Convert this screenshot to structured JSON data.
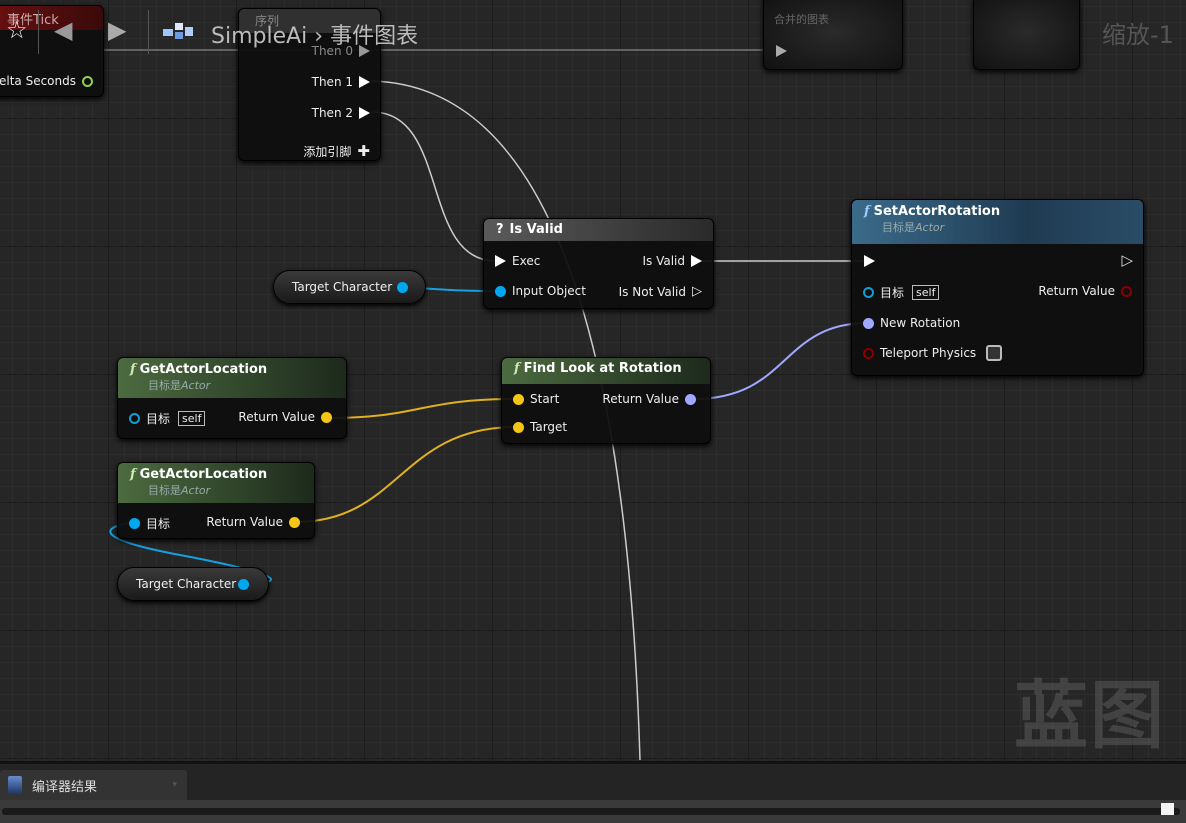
{
  "toolbar": {
    "breadcrumb_root": "SimpleAi",
    "breadcrumb_sep": "›",
    "breadcrumb_current": "事件图表",
    "zoom_label": "缩放-1",
    "icons": [
      "star-icon",
      "back-arrow-icon",
      "forward-arrow-icon",
      "blueprint-icon"
    ]
  },
  "nodes": {
    "event_tick": {
      "title": "事件Tick",
      "pin_delta": "elta Seconds"
    },
    "sequence": {
      "title": "序列",
      "then0": "Then 0",
      "then1": "Then 1",
      "then2": "Then 2",
      "add_pin": "添加引脚"
    },
    "collapsed": {
      "subtitle": "合并的图表"
    },
    "is_valid": {
      "title": "Is Valid",
      "exec": "Exec",
      "input": "Input Object",
      "out_valid": "Is Valid",
      "out_not_valid": "Is Not Valid"
    },
    "target_char_1": {
      "label": "Target Character"
    },
    "target_char_2": {
      "label": "Target Character"
    },
    "set_rot": {
      "title": "SetActorRotation",
      "sub_prefix": "目标是",
      "sub_class": "Actor",
      "target": "目标",
      "self": "self",
      "ret": "Return Value",
      "new_rot": "New Rotation",
      "teleport": "Teleport Physics",
      "teleport_checked": false
    },
    "get_loc_1": {
      "title": "GetActorLocation",
      "sub_prefix": "目标是",
      "sub_class": "Actor",
      "target": "目标",
      "self": "self",
      "ret": "Return Value"
    },
    "get_loc_2": {
      "title": "GetActorLocation",
      "sub_prefix": "目标是",
      "sub_class": "Actor",
      "target": "目标",
      "ret": "Return Value"
    },
    "find_look": {
      "title": "Find Look at Rotation",
      "start": "Start",
      "target": "Target",
      "ret": "Return Value"
    }
  },
  "watermark": "蓝图",
  "bottom": {
    "tab_label": "编译器结果"
  },
  "colors": {
    "exec": "#ffffff",
    "object": "#00a8f0",
    "vector": "#f5c518",
    "rotator": "#a0a8ff",
    "bool": "#8a0000",
    "float": "#8fd14f"
  }
}
